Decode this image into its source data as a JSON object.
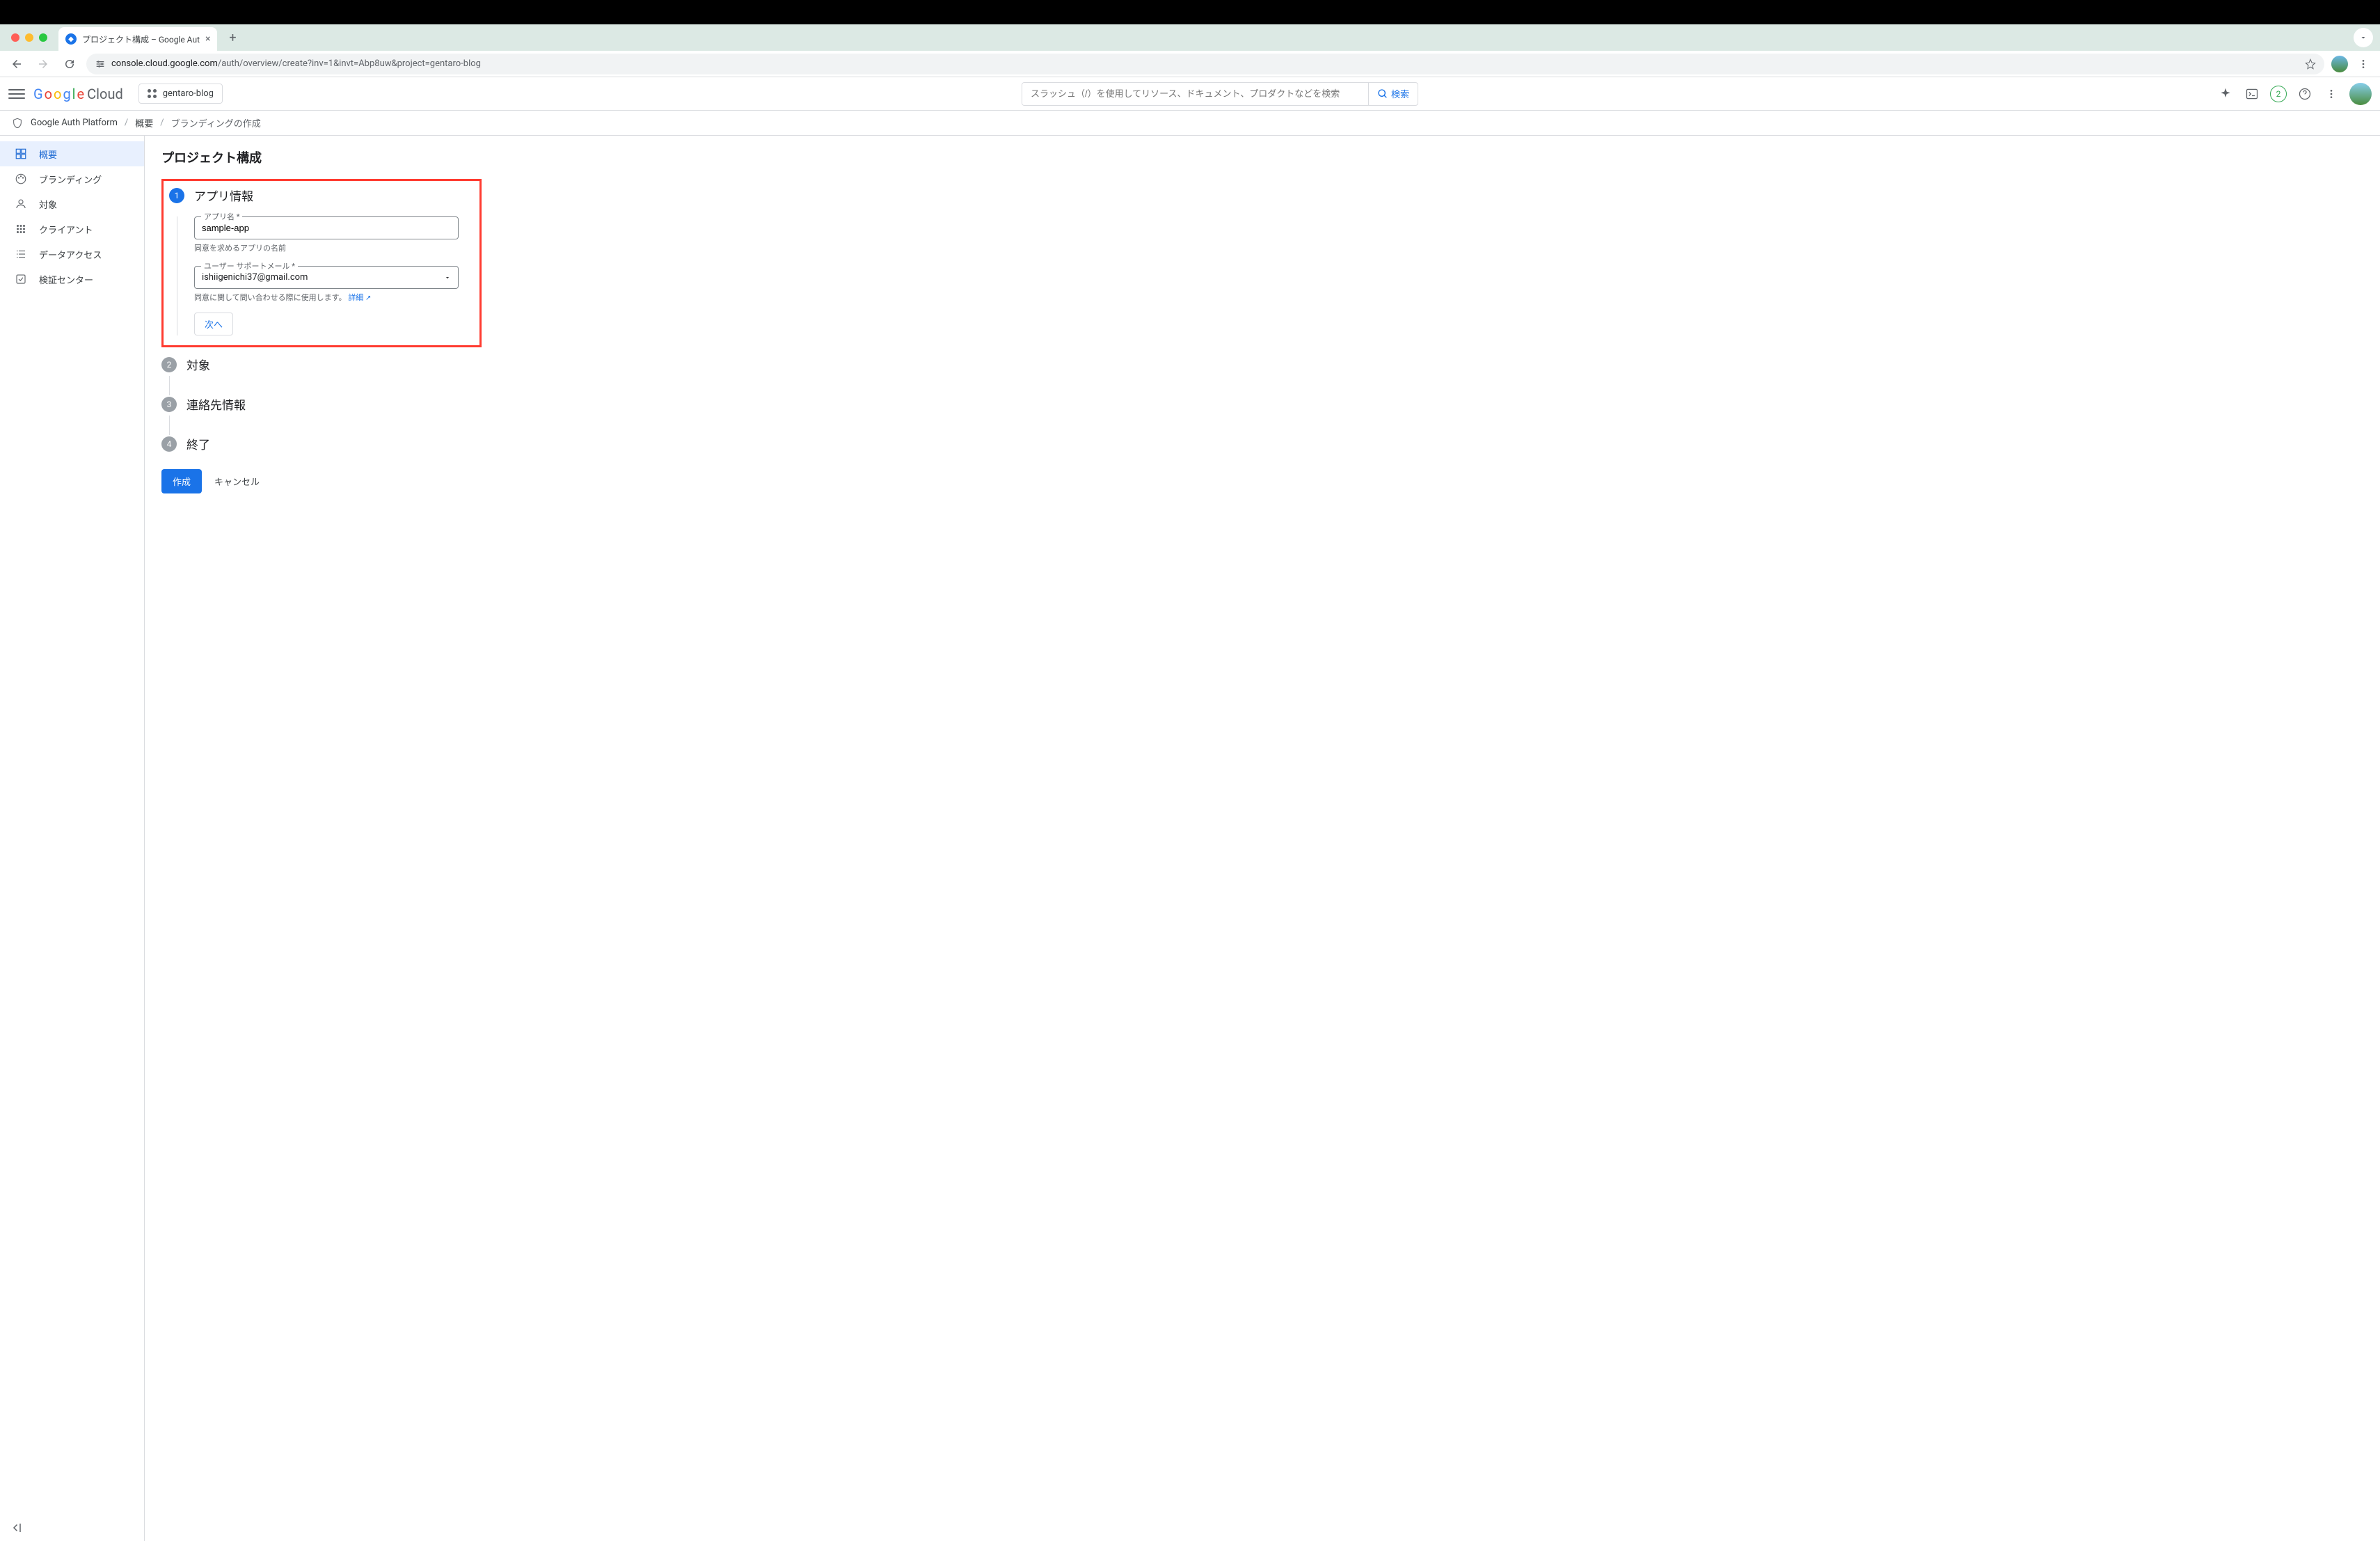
{
  "browser": {
    "tab_title": "プロジェクト構成 – Google Aut",
    "url_host": "console.cloud.google.com",
    "url_path": "/auth/overview/create?inv=1&invt=Abp8uw&project=gentaro-blog"
  },
  "header": {
    "project_name": "gentaro-blog",
    "search_placeholder": "スラッシュ（/）を使用してリソース、ドキュメント、プロダクトなどを検索",
    "search_button": "検索",
    "badge_count": "2"
  },
  "breadcrumb": {
    "root": "Google Auth Platform",
    "mid": "概要",
    "current": "ブランディングの作成"
  },
  "sidebar": {
    "items": [
      {
        "label": "概要"
      },
      {
        "label": "ブランディング"
      },
      {
        "label": "対象"
      },
      {
        "label": "クライアント"
      },
      {
        "label": "データアクセス"
      },
      {
        "label": "検証センター"
      }
    ]
  },
  "main": {
    "title": "プロジェクト構成",
    "step1": {
      "num": "1",
      "title": "アプリ情報",
      "app_name_label": "アプリ名 *",
      "app_name_value": "sample-app",
      "app_name_helper": "同意を求めるアプリの名前",
      "support_label": "ユーザー サポートメール *",
      "support_value": "ishiigenichi37@gmail.com",
      "support_helper": "同意に関して問い合わせる際に使用します。",
      "support_link": "詳細",
      "next": "次へ"
    },
    "step2": {
      "num": "2",
      "title": "対象"
    },
    "step3": {
      "num": "3",
      "title": "連絡先情報"
    },
    "step4": {
      "num": "4",
      "title": "終了"
    },
    "create_btn": "作成",
    "cancel_btn": "キャンセル"
  }
}
